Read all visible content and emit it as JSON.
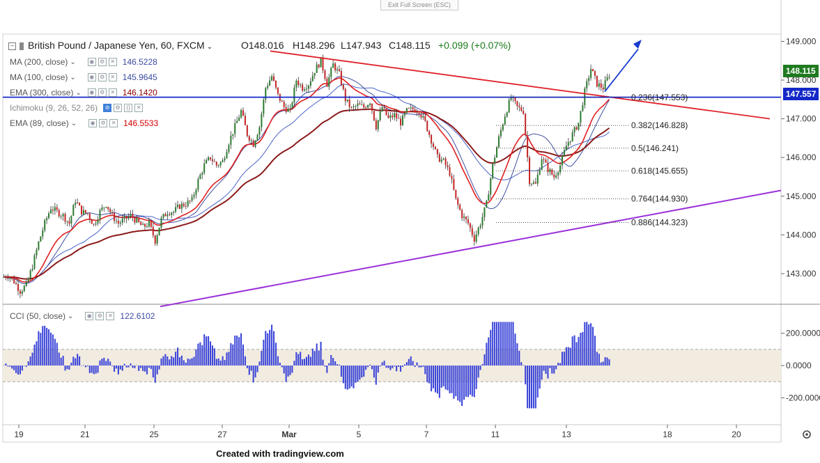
{
  "ui": {
    "exit_fullscreen": "Exit Full Screen (ESC)",
    "footer": "Created with tradingview.com"
  },
  "legend": {
    "symbol": "British Pound / Japanese Yen, 60, FXCM",
    "open": "O148.016",
    "high": "H148.296",
    "low": "L147.943",
    "close": "C148.115",
    "change": "+0.099 (+0.07%)",
    "indicators": [
      {
        "name": "MA (200, close)",
        "value": "146.5228",
        "color": "#3b4ba0"
      },
      {
        "name": "MA (100, close)",
        "value": "145.9645",
        "color": "#3b4ba0"
      },
      {
        "name": "EMA (300, close)",
        "value": "146.1420",
        "color": "#8b0000"
      },
      {
        "name": "Ichimoku (9, 26, 52, 26)",
        "value": "",
        "color": "#3b4ba0"
      },
      {
        "name": "EMA (89, close)",
        "value": "146.5533",
        "color": "#d40000"
      }
    ],
    "cci_name": "CCI (50, close)",
    "cci_value": "122.6102"
  },
  "colors": {
    "up": "#2e7d32",
    "down": "#c62828",
    "ma200": "#4a62c6",
    "ma100": "#3f4f9e",
    "ema300": "#8b1a1a",
    "ema89": "#e01e1e",
    "resist": "#e0232b",
    "support": "#9b30d9",
    "hline": "#1428c8",
    "fib": "#333333",
    "cci": "#3a44d8",
    "cci_band": "#f2ebe0"
  },
  "chart_data": {
    "type": "candlestick",
    "symbol": "British Pound / Japanese Yen",
    "timeframe": "60",
    "x_tick_labels": [
      "19",
      "21",
      "25",
      "27",
      "Mar",
      "5",
      "7",
      "11",
      "13",
      "18",
      "20"
    ],
    "y_ticks": [
      "149.000",
      "148.000",
      "147.000",
      "146.000",
      "145.000",
      "144.000",
      "143.000"
    ],
    "ylim": [
      142.15,
      149.35
    ],
    "last_price": "148.115",
    "horizontal_line": {
      "price": 147.557,
      "label": "147.557"
    },
    "fib_levels": [
      {
        "ratio": "0.236",
        "price": "147.553",
        "label": "0.236(147.553)"
      },
      {
        "ratio": "0.382",
        "price": "146.828",
        "label": "0.382(146.828)"
      },
      {
        "ratio": "0.5",
        "price": "146.241",
        "label": "0.5(146.241)"
      },
      {
        "ratio": "0.618",
        "price": "145.655",
        "label": "0.618(145.655)"
      },
      {
        "ratio": "0.764",
        "price": "144.930",
        "label": "0.764(144.930)"
      },
      {
        "ratio": "0.886",
        "price": "144.323",
        "label": "0.886(144.323)"
      }
    ],
    "price_path": [
      142.9,
      142.95,
      142.8,
      142.55,
      142.7,
      143.2,
      143.8,
      144.3,
      144.7,
      144.6,
      144.5,
      144.3,
      144.9,
      144.6,
      144.55,
      144.25,
      144.6,
      144.8,
      144.5,
      144.3,
      144.4,
      144.5,
      144.35,
      144.2,
      144.3,
      143.85,
      144.4,
      144.6,
      144.6,
      144.75,
      144.8,
      144.9,
      145.4,
      145.8,
      146.0,
      145.8,
      145.9,
      146.4,
      146.8,
      147.2,
      146.6,
      146.35,
      146.8,
      147.8,
      148.1,
      147.6,
      147.3,
      147.2,
      148.0,
      147.8,
      147.9,
      148.25,
      148.5,
      147.9,
      148.4,
      148.15,
      147.5,
      147.25,
      147.35,
      147.3,
      147.45,
      146.8,
      147.3,
      147.0,
      147.1,
      146.9,
      147.2,
      147.25,
      147.2,
      146.9,
      146.45,
      146.0,
      145.9,
      145.6,
      144.9,
      144.5,
      144.3,
      143.9,
      144.3,
      144.8,
      145.8,
      146.5,
      147.1,
      147.55,
      147.3,
      147.2,
      145.4,
      145.3,
      146.0,
      145.7,
      145.5,
      145.8,
      146.3,
      146.6,
      146.9,
      147.7,
      148.3,
      147.9,
      147.8,
      148.15
    ],
    "last_candle_x_day": 14.8,
    "cci_ylim": [
      -300,
      300
    ],
    "cci_ticks": [
      "200.0000",
      "0.0000",
      "-200.0000"
    ],
    "cci_band": [
      100,
      -100
    ]
  }
}
